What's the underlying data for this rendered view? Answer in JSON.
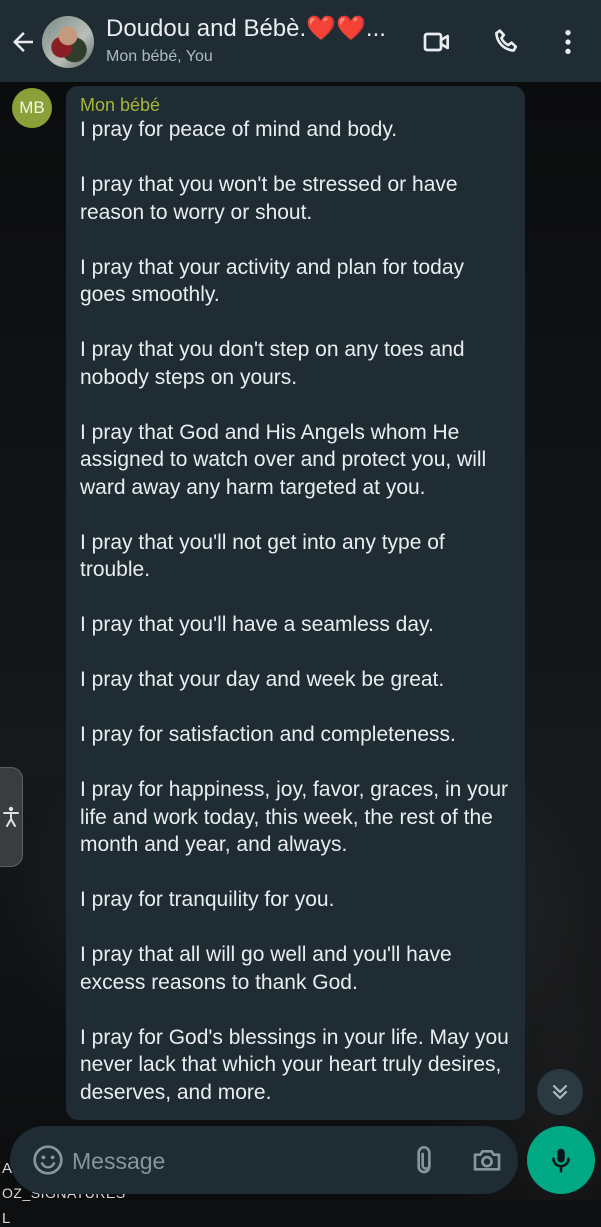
{
  "header": {
    "title": "Doudou and Bébè.❤️❤️...",
    "subtitle": "Mon bébé, You"
  },
  "message": {
    "avatar_initials": "MB",
    "sender": "Mon bébé",
    "paragraphs": [
      "I pray for peace of mind and body.",
      "I pray that you won't be stressed or have reason to worry or shout.",
      "I pray that your activity and plan for today goes smoothly.",
      "I pray that you don't step on any toes and nobody steps on yours.",
      "I pray that God and His Angels whom He assigned to watch over and protect you, will ward away any harm targeted at you.",
      "I pray that you'll not get into any type of trouble.",
      "I pray that you'll have a seamless day.",
      "I pray that your day and week be great.",
      "I pray for satisfaction and completeness.",
      "I pray for happiness, joy, favor, graces, in your life and work today, this week, the rest of the month and year, and always.",
      "I pray for tranquility for you.",
      "I pray that all will go well and you'll have excess reasons to thank God.",
      "I pray for God's blessings in your life. May you never lack that which your heart truly desires, deserves, and more."
    ]
  },
  "wallpaper_text": [
    "ANIE HA",
    "OZ_SIGNATURES",
    "L"
  ],
  "composer": {
    "placeholder": "Message"
  },
  "icons": {
    "back": "arrow-left-icon",
    "video": "video-call-icon",
    "call": "phone-icon",
    "menu": "more-vert-icon",
    "emoji": "emoji-icon",
    "attach": "paperclip-icon",
    "camera": "camera-icon",
    "mic": "microphone-icon",
    "scroll": "double-chevron-down-icon",
    "accessibility": "accessibility-icon"
  },
  "colors": {
    "header_bg": "#1f2c33",
    "bubble_bg": "#1f2c33",
    "sender_name": "#a7b63a",
    "accent_green": "#00a884"
  }
}
